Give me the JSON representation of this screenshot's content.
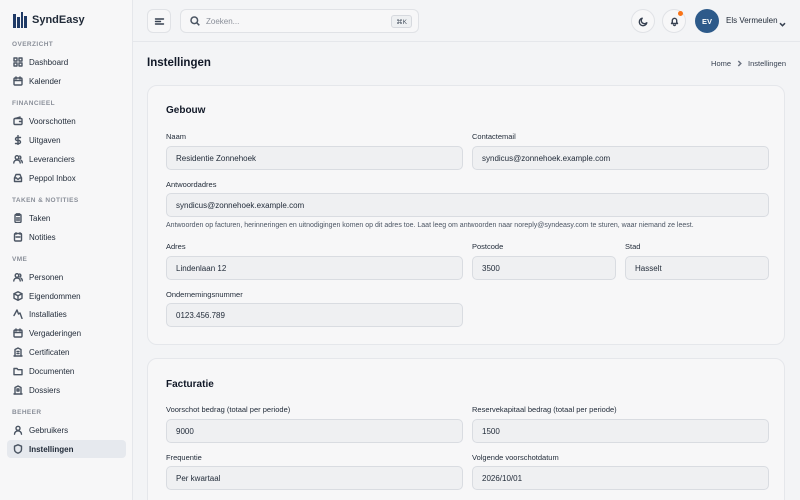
{
  "brand": {
    "name": "SyndEasy"
  },
  "sidebar": {
    "sections": [
      {
        "title": "OVERZICHT",
        "items": [
          {
            "label": "Dashboard",
            "icon": "grid-icon"
          },
          {
            "label": "Kalender",
            "icon": "calendar-icon"
          }
        ]
      },
      {
        "title": "FINANCIEEL",
        "items": [
          {
            "label": "Voorschotten",
            "icon": "wallet-icon"
          },
          {
            "label": "Uitgaven",
            "icon": "dollar-icon"
          },
          {
            "label": "Leveranciers",
            "icon": "users-icon"
          },
          {
            "label": "Peppol Inbox",
            "icon": "inbox-icon"
          }
        ]
      },
      {
        "title": "TAKEN & NOTITIES",
        "items": [
          {
            "label": "Taken",
            "icon": "clipboard-icon"
          },
          {
            "label": "Notities",
            "icon": "note-icon"
          }
        ]
      },
      {
        "title": "VME",
        "items": [
          {
            "label": "Personen",
            "icon": "people-icon"
          },
          {
            "label": "Eigendommen",
            "icon": "box-icon"
          },
          {
            "label": "Installaties",
            "icon": "bolt-icon"
          },
          {
            "label": "Vergaderingen",
            "icon": "calendar-check-icon"
          },
          {
            "label": "Certificaten",
            "icon": "certificate-icon"
          },
          {
            "label": "Documenten",
            "icon": "folder-icon"
          },
          {
            "label": "Dossiers",
            "icon": "dossier-icon"
          }
        ]
      },
      {
        "title": "BEHEER",
        "items": [
          {
            "label": "Gebruikers",
            "icon": "user-icon"
          },
          {
            "label": "Instellingen",
            "icon": "shield-icon",
            "active": true
          }
        ]
      }
    ]
  },
  "header": {
    "search_placeholder": "Zoeken...",
    "search_shortcut": "⌘K",
    "user_initials": "EV",
    "user_name": "Els Vermeulen",
    "notification_color": "#f97316"
  },
  "page": {
    "title": "Instellingen",
    "breadcrumb": [
      "Home",
      "Instellingen"
    ]
  },
  "gebouw": {
    "title": "Gebouw",
    "naam_label": "Naam",
    "naam_value": "Residentie Zonnehoek",
    "contact_label": "Contactemail",
    "contact_value": "syndicus@zonnehoek.example.com",
    "antwoord_label": "Antwoordadres",
    "antwoord_value": "syndicus@zonnehoek.example.com",
    "antwoord_hint": "Antwoorden op facturen, herinneringen en uitnodigingen komen op dit adres toe. Laat leeg om antwoorden naar noreply@syndeasy.com te sturen, waar niemand ze leest.",
    "adres_label": "Adres",
    "adres_value": "Lindenlaan 12",
    "postcode_label": "Postcode",
    "postcode_value": "3500",
    "stad_label": "Stad",
    "stad_value": "Hasselt",
    "onderneming_label": "Ondernemingsnummer",
    "onderneming_value": "0123.456.789"
  },
  "facturatie": {
    "title": "Facturatie",
    "voorschot_label": "Voorschot bedrag (totaal per periode)",
    "voorschot_value": "9000",
    "reserve_label": "Reservekapitaal bedrag (totaal per periode)",
    "reserve_value": "1500",
    "frequentie_label": "Frequentie",
    "frequentie_value": "Per kwartaal",
    "volgende_label": "Volgende voorschotdatum",
    "volgende_value": "2026/10/01"
  },
  "colors": {
    "brand": "#1f3a66",
    "avatar": "#2d5a8a",
    "active_nav_bg": "#e6e9ee"
  }
}
